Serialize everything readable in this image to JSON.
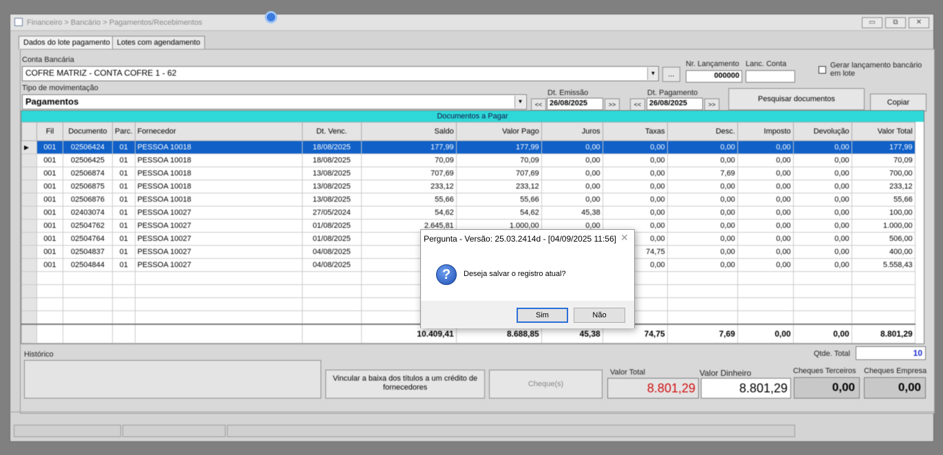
{
  "window": {
    "title": "Financeiro > Bancário > Pagamentos/Recebimentos",
    "minimize": "▭",
    "maximize": "⧉",
    "close": "✕"
  },
  "tabs": [
    "Dados do lote pagamento",
    "Lotes com agendamento"
  ],
  "form": {
    "conta_label": "Conta Bancária",
    "conta_value": "COFRE MATRIZ - CONTA COFRE 1 - 62",
    "ellipsis": "...",
    "nr_lancamento_label": "Nr. Lançamento",
    "nr_lancamento_value": "000000",
    "lanc_conta_label": "Lanc. Conta",
    "lanc_conta_value": "",
    "gerar_label": "Gerar lançamento bancário em lote",
    "tipo_label": "Tipo de movimentação",
    "tipo_value": "Pagamentos",
    "dt_emissao_label": "Dt. Emissão",
    "dt_emissao_value": "26/08/2025",
    "dt_pagamento_label": "Dt. Pagamento",
    "dt_pagamento_value": "26/08/2025",
    "prev": "<<",
    "next": ">>",
    "pesquisar": "Pesquisar documentos",
    "copiar": "Copiar"
  },
  "grid": {
    "caption": "Documentos a Pagar",
    "columns": [
      "Fil",
      "Documento",
      "Parc.",
      "Fornecedor",
      "Dt. Venc.",
      "Saldo",
      "Valor Pago",
      "Juros",
      "Taxas",
      "Desc.",
      "Imposto",
      "Devolução",
      "Valor Total"
    ],
    "rows": [
      [
        "001",
        "02506424",
        "01",
        "PESSOA 10018",
        "18/08/2025",
        "177,99",
        "177,99",
        "0,00",
        "0,00",
        "0,00",
        "0,00",
        "0,00",
        "177,99"
      ],
      [
        "001",
        "02506425",
        "01",
        "PESSOA 10018",
        "18/08/2025",
        "70,09",
        "70,09",
        "0,00",
        "0,00",
        "0,00",
        "0,00",
        "0,00",
        "70,09"
      ],
      [
        "001",
        "02506874",
        "01",
        "PESSOA 10018",
        "13/08/2025",
        "707,69",
        "707,69",
        "0,00",
        "0,00",
        "7,69",
        "0,00",
        "0,00",
        "700,00"
      ],
      [
        "001",
        "02506875",
        "01",
        "PESSOA 10018",
        "13/08/2025",
        "233,12",
        "233,12",
        "0,00",
        "0,00",
        "0,00",
        "0,00",
        "0,00",
        "233,12"
      ],
      [
        "001",
        "02506876",
        "01",
        "PESSOA 10018",
        "13/08/2025",
        "55,66",
        "55,66",
        "0,00",
        "0,00",
        "0,00",
        "0,00",
        "0,00",
        "55,66"
      ],
      [
        "001",
        "02403074",
        "01",
        "PESSOA 10027",
        "27/05/2024",
        "54,62",
        "54,62",
        "45,38",
        "0,00",
        "0,00",
        "0,00",
        "0,00",
        "100,00"
      ],
      [
        "001",
        "02504762",
        "01",
        "PESSOA 10027",
        "01/08/2025",
        "2.645,81",
        "1.000,00",
        "0,00",
        "0,00",
        "0,00",
        "0,00",
        "0,00",
        "1.000,00"
      ],
      [
        "001",
        "02504764",
        "01",
        "PESSOA 10027",
        "01/08/2025",
        "",
        "",
        "",
        "0,00",
        "0,00",
        "0,00",
        "0,00",
        "506,00"
      ],
      [
        "001",
        "02504837",
        "01",
        "PESSOA 10027",
        "04/08/2025",
        "",
        "",
        "",
        "74,75",
        "0,00",
        "0,00",
        "0,00",
        "400,00"
      ],
      [
        "001",
        "02504844",
        "01",
        "PESSOA 10027",
        "04/08/2025",
        "",
        "",
        "",
        "0,00",
        "0,00",
        "0,00",
        "0,00",
        "5.558,43"
      ]
    ],
    "totals": [
      "",
      "",
      "",
      "",
      "",
      "10.409,41",
      "8.688,85",
      "45,38",
      "74,75",
      "7,69",
      "0,00",
      "0,00",
      "8.801,29"
    ]
  },
  "bottom": {
    "historico_label": "Histórico",
    "qtde_label": "Qtde. Total",
    "qtde_value": "10",
    "vincular_label": "Vincular a baixa dos títulos a um crédito de fornecedores",
    "cheques_label": "Cheque(s)",
    "valor_total_label": "Valor Total",
    "valor_total_value": "8.801,29",
    "valor_dinheiro_label": "Valor Dinheiro",
    "valor_dinheiro_value": "8.801,29",
    "cheques_terceiros_label": "Cheques Terceiros",
    "cheques_terceiros_value": "0,00",
    "cheques_empresa_label": "Cheques Empresa",
    "cheques_empresa_value": "0,00"
  },
  "dialog": {
    "title": "Pergunta - Versão: 25.03.2414d - [04/09/2025 11:56]",
    "close": "✕",
    "icon": "question-icon",
    "message": "Deseja salvar o registro atual?",
    "yes": "Sim",
    "no": "Não"
  },
  "colors": {
    "selection": "#1060c8",
    "caption": "#2fd8d8",
    "total_red": "#d01010",
    "qtde_blue": "#1a2ad0"
  }
}
